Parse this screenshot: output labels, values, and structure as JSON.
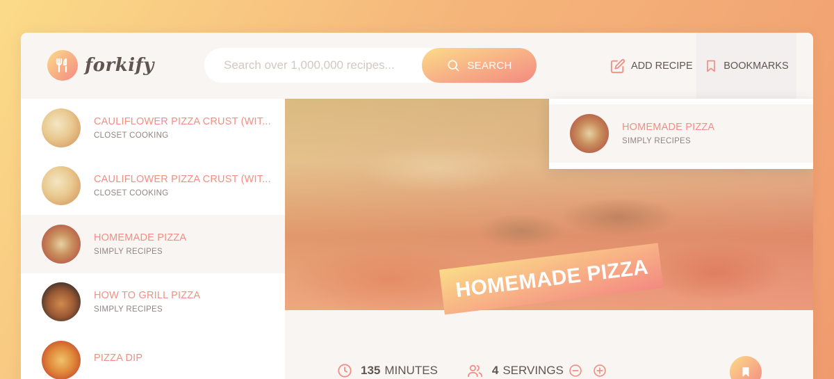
{
  "app": {
    "name": "forkify"
  },
  "search": {
    "placeholder": "Search over 1,000,000 recipes...",
    "button_label": "SEARCH"
  },
  "nav": {
    "add_recipe": "ADD RECIPE",
    "bookmarks": "BOOKMARKS"
  },
  "results": [
    {
      "title": "CAULIFLOWER PIZZA CRUST (WIT...",
      "publisher": "CLOSET COOKING",
      "active": false
    },
    {
      "title": "CAULIFLOWER PIZZA CRUST (WIT...",
      "publisher": "CLOSET COOKING",
      "active": false
    },
    {
      "title": "HOMEMADE PIZZA",
      "publisher": "SIMPLY RECIPES",
      "active": true
    },
    {
      "title": "HOW TO GRILL PIZZA",
      "publisher": "SIMPLY RECIPES",
      "active": false
    },
    {
      "title": "PIZZA DIP",
      "publisher": "",
      "active": false
    }
  ],
  "bookmarks_panel": [
    {
      "title": "HOMEMADE PIZZA",
      "publisher": "SIMPLY RECIPES"
    }
  ],
  "recipe": {
    "title": "HOMEMADE PIZZA",
    "cooking_time": "135",
    "cooking_time_unit": "MINUTES",
    "servings": "4",
    "servings_unit": "SERVINGS"
  },
  "icons": {
    "logo": "fork-knife-icon",
    "search": "search-icon",
    "add_recipe": "edit-icon",
    "bookmarks": "bookmark-icon",
    "time": "clock-icon",
    "servings": "users-icon",
    "decrease": "minus-circle-icon",
    "increase": "plus-circle-icon"
  },
  "colors": {
    "accent_start": "#fbdb89",
    "accent_end": "#f48982",
    "title_text": "#f38e82",
    "body_text": "#615551",
    "light_bg": "#f9f5f3"
  }
}
